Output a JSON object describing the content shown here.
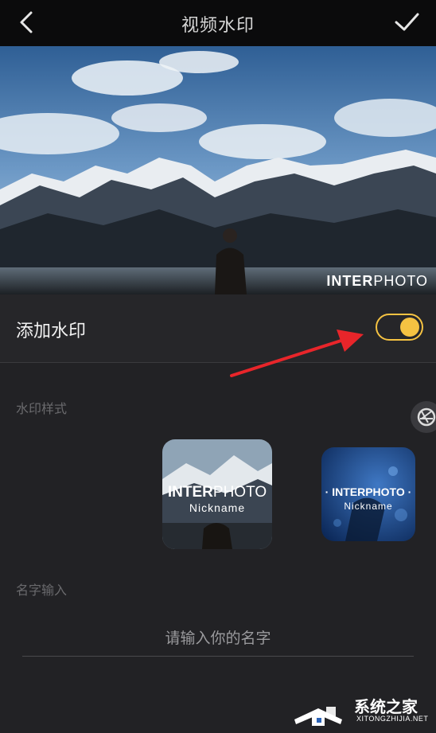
{
  "header": {
    "title": "视频水印"
  },
  "preview": {
    "watermark_bold": "INTER",
    "watermark_light": "PHOTO"
  },
  "watermark_toggle": {
    "label": "添加水印",
    "enabled": true
  },
  "style_section": {
    "label": "水印样式",
    "cards": [
      {
        "brand_bold": "INTER",
        "brand_light": "PHOTO",
        "nickname": "Nickname"
      },
      {
        "brand": "· INTERPHOTO ·",
        "nickname": "Nickname"
      }
    ]
  },
  "name_section": {
    "label": "名字输入",
    "placeholder": "请输入你的名字"
  },
  "site_watermark": {
    "name": "系统之家",
    "url": "XITONGZHIJIA.NET"
  },
  "colors": {
    "accent": "#f5c242",
    "background": "#222225",
    "topbar": "#0b0b0c",
    "arrow": "#e8252a"
  }
}
